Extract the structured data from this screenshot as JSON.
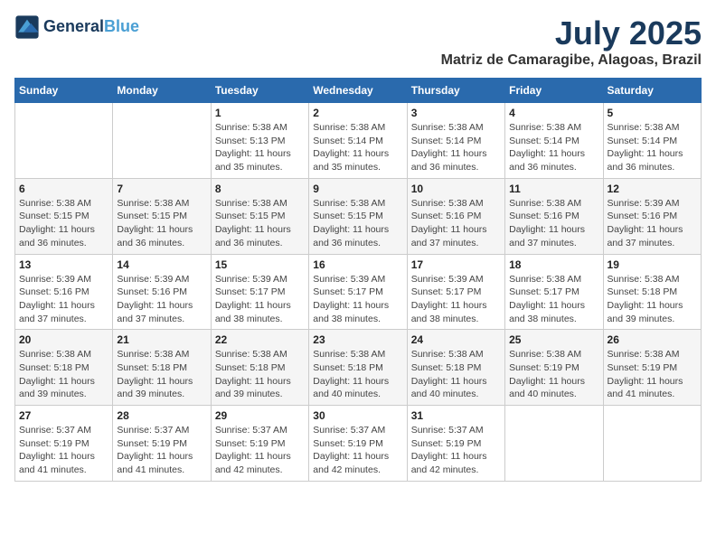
{
  "header": {
    "logo_line1": "General",
    "logo_line2": "Blue",
    "month": "July 2025",
    "location": "Matriz de Camaragibe, Alagoas, Brazil"
  },
  "weekdays": [
    "Sunday",
    "Monday",
    "Tuesday",
    "Wednesday",
    "Thursday",
    "Friday",
    "Saturday"
  ],
  "weeks": [
    [
      {
        "day": "",
        "info": ""
      },
      {
        "day": "",
        "info": ""
      },
      {
        "day": "1",
        "info": "Sunrise: 5:38 AM\nSunset: 5:13 PM\nDaylight: 11 hours and 35 minutes."
      },
      {
        "day": "2",
        "info": "Sunrise: 5:38 AM\nSunset: 5:14 PM\nDaylight: 11 hours and 35 minutes."
      },
      {
        "day": "3",
        "info": "Sunrise: 5:38 AM\nSunset: 5:14 PM\nDaylight: 11 hours and 36 minutes."
      },
      {
        "day": "4",
        "info": "Sunrise: 5:38 AM\nSunset: 5:14 PM\nDaylight: 11 hours and 36 minutes."
      },
      {
        "day": "5",
        "info": "Sunrise: 5:38 AM\nSunset: 5:14 PM\nDaylight: 11 hours and 36 minutes."
      }
    ],
    [
      {
        "day": "6",
        "info": "Sunrise: 5:38 AM\nSunset: 5:15 PM\nDaylight: 11 hours and 36 minutes."
      },
      {
        "day": "7",
        "info": "Sunrise: 5:38 AM\nSunset: 5:15 PM\nDaylight: 11 hours and 36 minutes."
      },
      {
        "day": "8",
        "info": "Sunrise: 5:38 AM\nSunset: 5:15 PM\nDaylight: 11 hours and 36 minutes."
      },
      {
        "day": "9",
        "info": "Sunrise: 5:38 AM\nSunset: 5:15 PM\nDaylight: 11 hours and 36 minutes."
      },
      {
        "day": "10",
        "info": "Sunrise: 5:38 AM\nSunset: 5:16 PM\nDaylight: 11 hours and 37 minutes."
      },
      {
        "day": "11",
        "info": "Sunrise: 5:38 AM\nSunset: 5:16 PM\nDaylight: 11 hours and 37 minutes."
      },
      {
        "day": "12",
        "info": "Sunrise: 5:39 AM\nSunset: 5:16 PM\nDaylight: 11 hours and 37 minutes."
      }
    ],
    [
      {
        "day": "13",
        "info": "Sunrise: 5:39 AM\nSunset: 5:16 PM\nDaylight: 11 hours and 37 minutes."
      },
      {
        "day": "14",
        "info": "Sunrise: 5:39 AM\nSunset: 5:16 PM\nDaylight: 11 hours and 37 minutes."
      },
      {
        "day": "15",
        "info": "Sunrise: 5:39 AM\nSunset: 5:17 PM\nDaylight: 11 hours and 38 minutes."
      },
      {
        "day": "16",
        "info": "Sunrise: 5:39 AM\nSunset: 5:17 PM\nDaylight: 11 hours and 38 minutes."
      },
      {
        "day": "17",
        "info": "Sunrise: 5:39 AM\nSunset: 5:17 PM\nDaylight: 11 hours and 38 minutes."
      },
      {
        "day": "18",
        "info": "Sunrise: 5:38 AM\nSunset: 5:17 PM\nDaylight: 11 hours and 38 minutes."
      },
      {
        "day": "19",
        "info": "Sunrise: 5:38 AM\nSunset: 5:18 PM\nDaylight: 11 hours and 39 minutes."
      }
    ],
    [
      {
        "day": "20",
        "info": "Sunrise: 5:38 AM\nSunset: 5:18 PM\nDaylight: 11 hours and 39 minutes."
      },
      {
        "day": "21",
        "info": "Sunrise: 5:38 AM\nSunset: 5:18 PM\nDaylight: 11 hours and 39 minutes."
      },
      {
        "day": "22",
        "info": "Sunrise: 5:38 AM\nSunset: 5:18 PM\nDaylight: 11 hours and 39 minutes."
      },
      {
        "day": "23",
        "info": "Sunrise: 5:38 AM\nSunset: 5:18 PM\nDaylight: 11 hours and 40 minutes."
      },
      {
        "day": "24",
        "info": "Sunrise: 5:38 AM\nSunset: 5:18 PM\nDaylight: 11 hours and 40 minutes."
      },
      {
        "day": "25",
        "info": "Sunrise: 5:38 AM\nSunset: 5:19 PM\nDaylight: 11 hours and 40 minutes."
      },
      {
        "day": "26",
        "info": "Sunrise: 5:38 AM\nSunset: 5:19 PM\nDaylight: 11 hours and 41 minutes."
      }
    ],
    [
      {
        "day": "27",
        "info": "Sunrise: 5:37 AM\nSunset: 5:19 PM\nDaylight: 11 hours and 41 minutes."
      },
      {
        "day": "28",
        "info": "Sunrise: 5:37 AM\nSunset: 5:19 PM\nDaylight: 11 hours and 41 minutes."
      },
      {
        "day": "29",
        "info": "Sunrise: 5:37 AM\nSunset: 5:19 PM\nDaylight: 11 hours and 42 minutes."
      },
      {
        "day": "30",
        "info": "Sunrise: 5:37 AM\nSunset: 5:19 PM\nDaylight: 11 hours and 42 minutes."
      },
      {
        "day": "31",
        "info": "Sunrise: 5:37 AM\nSunset: 5:19 PM\nDaylight: 11 hours and 42 minutes."
      },
      {
        "day": "",
        "info": ""
      },
      {
        "day": "",
        "info": ""
      }
    ]
  ]
}
